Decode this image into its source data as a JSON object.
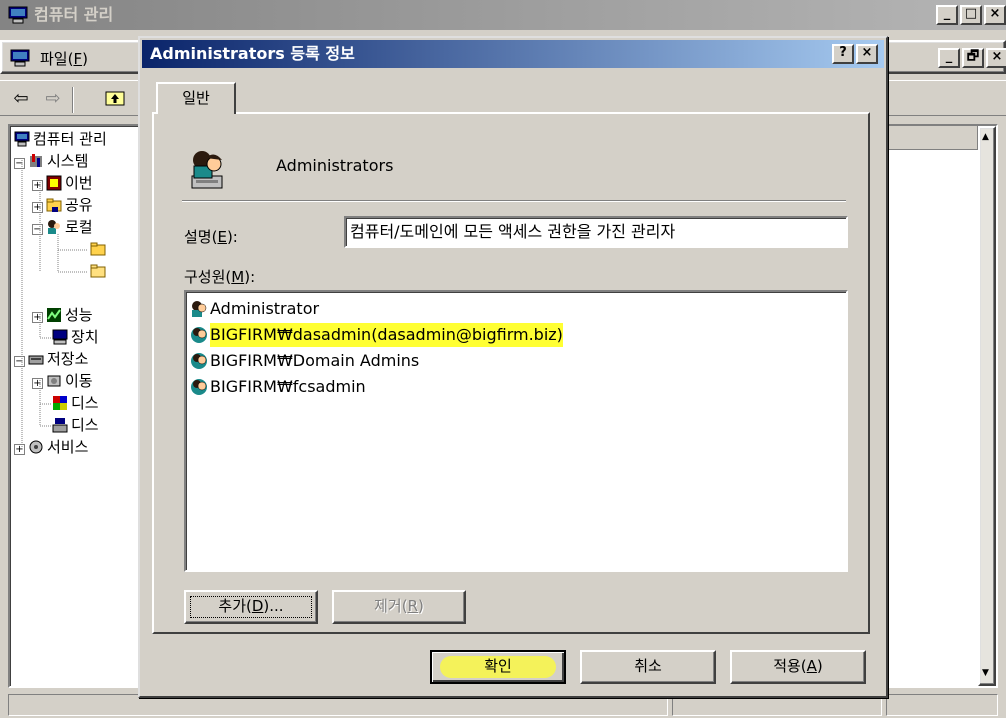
{
  "main_window": {
    "title": "컴퓨터 관리",
    "buttons": [
      "_",
      "□",
      "×"
    ],
    "menu": {
      "file": "파일(",
      "file_key": "F",
      "file_end": ")"
    },
    "doc_buttons": [
      "_",
      "🗗",
      "×"
    ]
  },
  "tree": {
    "items": [
      {
        "label": "컴퓨터 관리",
        "icon": "computer-icon"
      },
      {
        "label": "시스템",
        "icon": "tools-icon",
        "expander": "−"
      },
      {
        "label": "이번",
        "icon": "event-viewer-icon",
        "expander": "+"
      },
      {
        "label": "공유",
        "icon": "shared-folder-icon",
        "expander": "+"
      },
      {
        "label": "로컬",
        "icon": "users-icon",
        "expander": "−"
      },
      {
        "label": "",
        "icon": "folder-icon"
      },
      {
        "label": "",
        "icon": "folder-icon"
      },
      {
        "label": "성능",
        "icon": "performance-icon",
        "expander": "+"
      },
      {
        "label": "장치",
        "icon": "device-manager-icon"
      },
      {
        "label": "저장소",
        "icon": "storage-icon",
        "expander": "−"
      },
      {
        "label": "이동",
        "icon": "removable-storage-icon",
        "expander": "+"
      },
      {
        "label": "디스",
        "icon": "defrag-icon"
      },
      {
        "label": "디스",
        "icon": "disk-management-icon"
      },
      {
        "label": "서비스",
        "icon": "services-icon",
        "expander": "+"
      }
    ]
  },
  "dialog": {
    "title": "Administrators 등록 정보",
    "help_button": "?",
    "close_button": "×",
    "tab_label": "일반",
    "group_name": "Administrators",
    "description": {
      "label_pre": "설명(",
      "label_key": "E",
      "label_post": "):",
      "value": "컴퓨터/도메인에 모든 액세스 권한을 가진 관리자"
    },
    "members": {
      "label_pre": "구성원(",
      "label_key": "M",
      "label_post": "):",
      "items": [
        {
          "name": "Administrator",
          "highlighted": false
        },
        {
          "name": "BIGFIRM₩dasadmin(dasadmin@bigfirm.biz)",
          "highlighted": true
        },
        {
          "name": "BIGFIRM₩Domain Admins",
          "highlighted": false
        },
        {
          "name": "BIGFIRM₩fcsadmin",
          "highlighted": false
        }
      ]
    },
    "add_button": {
      "pre": "추가(",
      "key": "D",
      "post": ")..."
    },
    "remove_button": {
      "pre": "제거(",
      "key": "R",
      "post": ")"
    },
    "ok_button": "확인",
    "cancel_button": "취소",
    "apply_button": {
      "pre": "적용(",
      "key": "A",
      "post": ")"
    }
  },
  "colors": {
    "dialog_title_start": "#0a246a",
    "dialog_title_end": "#a6caf0",
    "highlight": "#ffff33"
  }
}
